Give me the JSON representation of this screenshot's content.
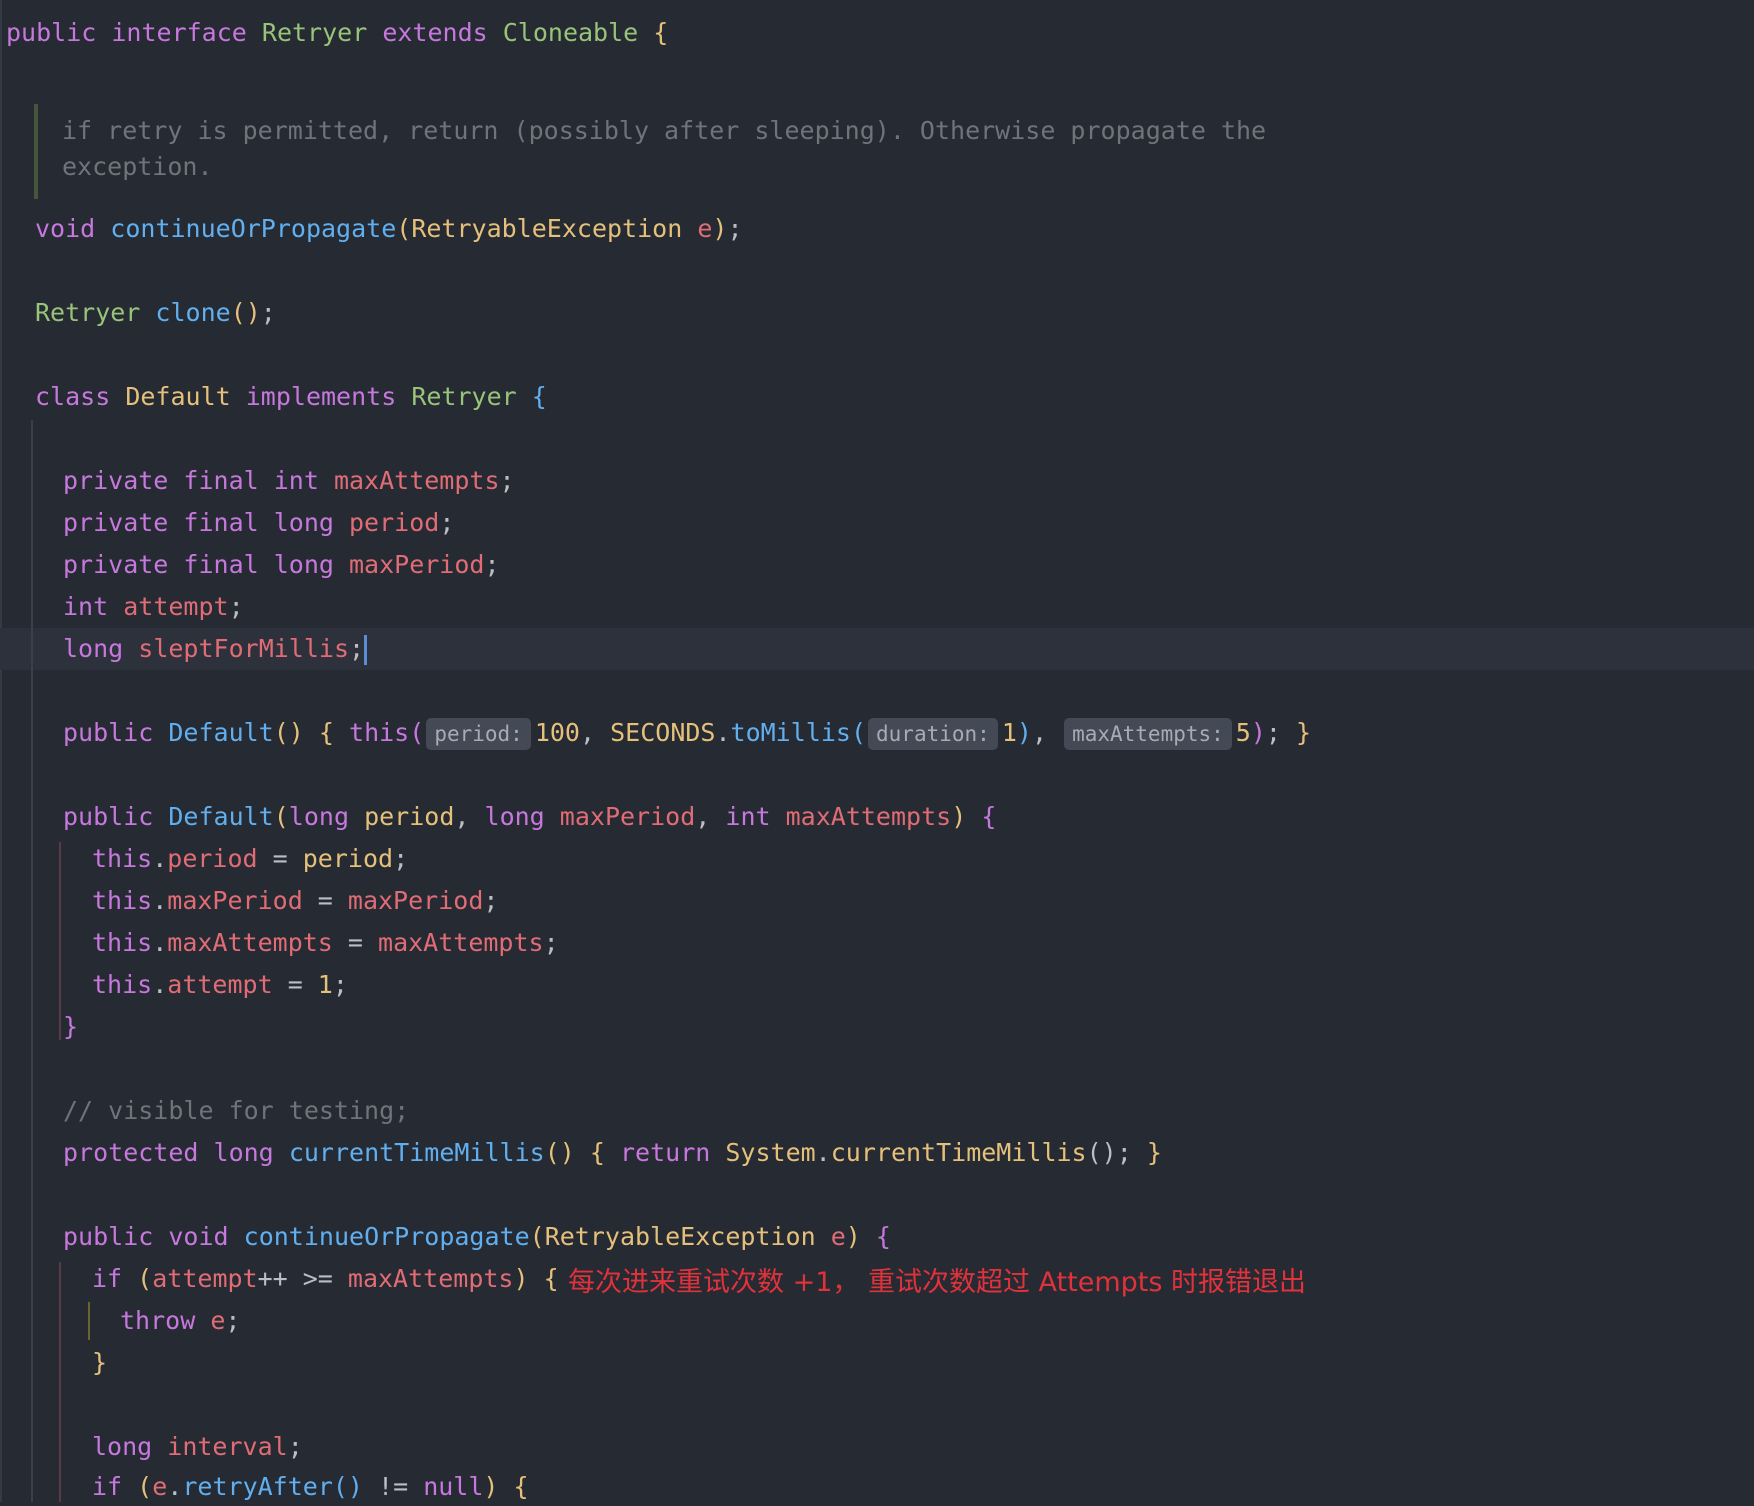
{
  "code": {
    "l1": {
      "kw1": "public",
      "kw2": "interface",
      "name": "Retryer",
      "kw3": "extends",
      "parent": "Cloneable",
      "brace": "{"
    },
    "doc": {
      "line1": "if retry is permitted, return (possibly after sleeping). Otherwise propagate the",
      "line2": "exception."
    },
    "l2": {
      "kw": "void",
      "fn": "continueOrPropagate",
      "open": "(",
      "type": "RetryableException",
      "param": "e",
      "close": ")",
      "semi": ";"
    },
    "l3": {
      "type": "Retryer",
      "fn": "clone",
      "parens": "()",
      "semi": ";"
    },
    "l4": {
      "kw1": "class",
      "name": "Default",
      "kw2": "implements",
      "iface": "Retryer",
      "brace": "{"
    },
    "f1": {
      "mods": "private final int",
      "name": "maxAttempts",
      "semi": ";"
    },
    "f2": {
      "mods": "private final long",
      "name": "period",
      "semi": ";"
    },
    "f3": {
      "mods": "private final long",
      "name": "maxPeriod",
      "semi": ";"
    },
    "f4": {
      "mods": "int",
      "name": "attempt",
      "semi": ";"
    },
    "f5": {
      "mods": "long",
      "name": "sleptForMillis",
      "semi": ";"
    },
    "c1": {
      "kw": "public",
      "fn": "Default",
      "parens": "()",
      "ob": "{",
      "this": "this",
      "open": "(",
      "hint1": "period:",
      "v1": "100",
      "comma1": ",",
      "cls": "SECONDS",
      "dot": ".",
      "fn2": "toMillis",
      "open2": "(",
      "hint2": "duration:",
      "v2": "1",
      "close2": ")",
      "comma2": ",",
      "hint3": "maxAttempts:",
      "v3": "5",
      "close": ")",
      "semi": ";",
      "cb": "}"
    },
    "c2": {
      "kw": "public",
      "fn": "Default",
      "open": "(",
      "t1": "long",
      "p1": "period",
      "comma1": ",",
      "t2": "long",
      "p2": "maxPeriod",
      "comma2": ",",
      "t3": "int",
      "p3": "maxAttempts",
      "close": ")",
      "brace": "{"
    },
    "a1": {
      "this": "this",
      "dot": ".",
      "field": "period",
      "eq": " = ",
      "val": "period",
      "semi": ";"
    },
    "a2": {
      "this": "this",
      "dot": ".",
      "field": "maxPeriod",
      "eq": " = ",
      "val": "maxPeriod",
      "semi": ";"
    },
    "a3": {
      "this": "this",
      "dot": ".",
      "field": "maxAttempts",
      "eq": " = ",
      "val": "maxAttempts",
      "semi": ";"
    },
    "a4": {
      "this": "this",
      "dot": ".",
      "field": "attempt",
      "eq": " = ",
      "val": "1",
      "semi": ";"
    },
    "c2end": "}",
    "cmt": "// visible for testing;",
    "m1": {
      "kw1": "protected",
      "kw2": "long",
      "fn": "currentTimeMillis",
      "parens": "()",
      "ob": "{",
      "ret": "return",
      "cls": "System",
      "dot": ".",
      "fn2": "currentTimeMillis",
      "parens2": "()",
      "semi": ";",
      "cb": "}"
    },
    "m2": {
      "kw1": "public",
      "kw2": "void",
      "fn": "continueOrPropagate",
      "open": "(",
      "type": "RetryableException",
      "param": "e",
      "close": ")",
      "brace": "{"
    },
    "if1": {
      "kw": "if",
      "open": "(",
      "var": "attempt",
      "op": "++ >= ",
      "var2": "maxAttempts",
      "close": ")",
      "brace": "{"
    },
    "annotation": "每次进来重试次数 +1， 重试次数超过 Attempts 时报错退出",
    "throw": {
      "kw": "throw",
      "param": "e",
      "semi": ";"
    },
    "if1end": "}",
    "l_interval": {
      "kw": "long",
      "name": "interval",
      "semi": ";"
    },
    "if2": {
      "kw": "if",
      "open": "(",
      "param": "e",
      "dot": ".",
      "fn": "retryAfter",
      "parens": "()",
      "op": " != ",
      "null": "null",
      "close": ")",
      "brace": "{"
    }
  }
}
